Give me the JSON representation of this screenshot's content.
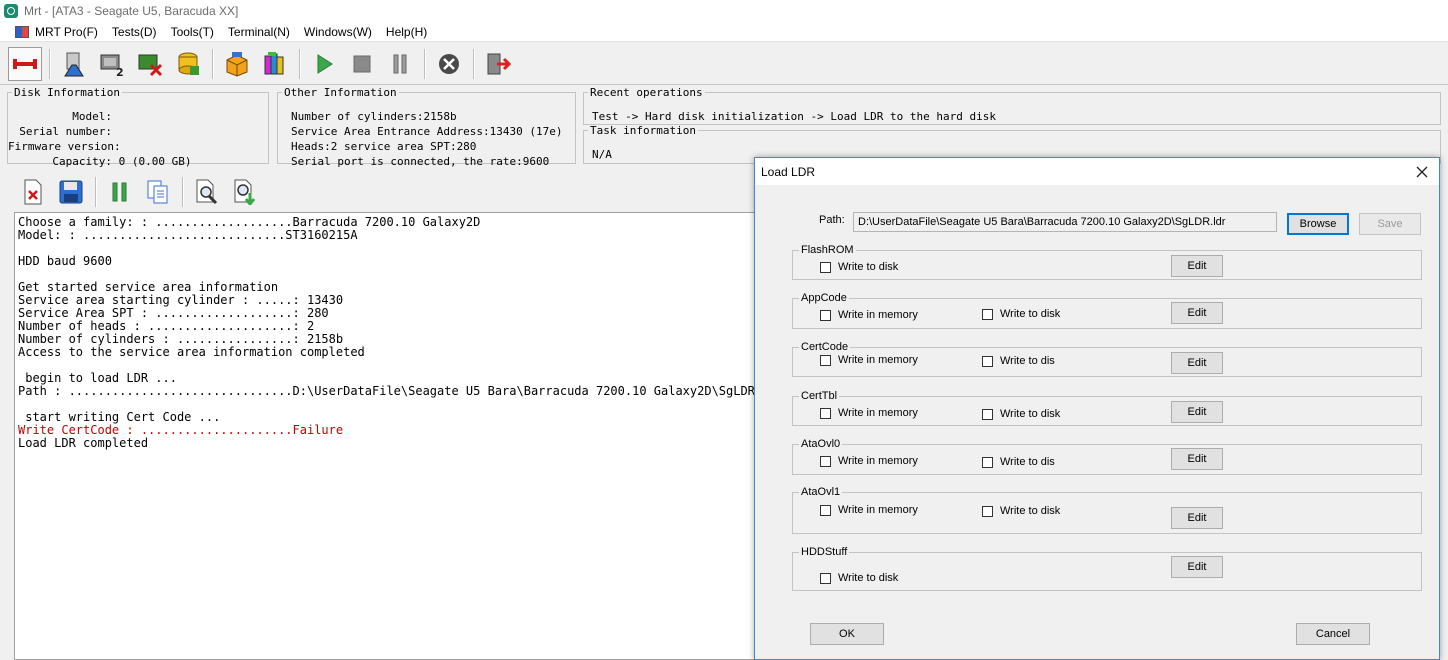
{
  "window": {
    "title": "Mrt - [ATA3 - Seagate U5, Baracuda XX]"
  },
  "menu": [
    "MRT Pro(F)",
    "Tests(D)",
    "Tools(T)",
    "Terminal(N)",
    "Windows(W)",
    "Help(H)"
  ],
  "disk_info": {
    "legend": "Disk Information",
    "rows": [
      {
        "label": "Model:",
        "value": ""
      },
      {
        "label": "Serial number:",
        "value": ""
      },
      {
        "label": "Firmware version:",
        "value": ""
      },
      {
        "label": "Capacity:",
        "value": "0 (0.00 GB)"
      }
    ]
  },
  "other_info": {
    "legend": "Other Information",
    "lines": [
      "Number of cylinders:2158b",
      "Service Area Entrance Address:13430 (17e)",
      "Heads:2 service area SPT:280",
      "Serial port is connected, the rate:9600"
    ]
  },
  "recent": {
    "legend": "Recent operations",
    "text": "Test -> Hard disk initialization -> Load LDR to the hard disk"
  },
  "task": {
    "legend": "Task information",
    "text": "N/A"
  },
  "log": [
    {
      "text": "Choose a family: : ...................Barracuda 7200.10 Galaxy2D",
      "red": false
    },
    {
      "text": "Model: : ............................ST3160215A",
      "red": false
    },
    {
      "text": "",
      "red": false
    },
    {
      "text": "HDD baud 9600",
      "red": false
    },
    {
      "text": "",
      "red": false
    },
    {
      "text": "Get started service area information",
      "red": false
    },
    {
      "text": "Service area starting cylinder : .....: 13430",
      "red": false
    },
    {
      "text": "Service Area SPT : ...................: 280",
      "red": false
    },
    {
      "text": "Number of heads : ....................: 2",
      "red": false
    },
    {
      "text": "Number of cylinders : ................: 2158b",
      "red": false
    },
    {
      "text": "Access to the service area information completed",
      "red": false
    },
    {
      "text": "",
      "red": false
    },
    {
      "text": " begin to load LDR ...",
      "red": false
    },
    {
      "text": "Path : ...............................D:\\UserDataFile\\Seagate U5 Bara\\Barracuda 7200.10 Galaxy2D\\SgLDR.ldr",
      "red": false
    },
    {
      "text": "",
      "red": false
    },
    {
      "text": " start writing Cert Code ...",
      "red": false
    },
    {
      "text": "Write CertCode : .....................Failure",
      "red": true
    },
    {
      "text": "Load LDR completed",
      "red": false
    }
  ],
  "dialog": {
    "title": "Load LDR",
    "path_label": "Path:",
    "path_value": "D:\\UserDataFile\\Seagate U5 Bara\\Barracuda 7200.10 Galaxy2D\\SgLDR.ldr",
    "browse": "Browse",
    "save": "Save",
    "sections": [
      {
        "legend": "FlashROM",
        "mem": "",
        "disk": "Write to disk",
        "edit": "Edit"
      },
      {
        "legend": "AppCode",
        "mem": "Write in memory",
        "disk": "Write to disk",
        "edit": "Edit"
      },
      {
        "legend": "CertCode",
        "mem": "Write in memory",
        "disk": "Write to dis",
        "edit": "Edit"
      },
      {
        "legend": "CertTbl",
        "mem": "Write in memory",
        "disk": "Write to disk",
        "edit": "Edit"
      },
      {
        "legend": "AtaOvl0",
        "mem": "Write in memory",
        "disk": "Write to dis",
        "edit": "Edit"
      },
      {
        "legend": "AtaOvl1",
        "mem": "Write in memory",
        "disk": "Write to disk",
        "edit": "Edit"
      },
      {
        "legend": "HDDStuff",
        "mem": "",
        "disk": "Write to disk",
        "edit": "Edit"
      }
    ],
    "ok": "OK",
    "cancel": "Cancel"
  }
}
